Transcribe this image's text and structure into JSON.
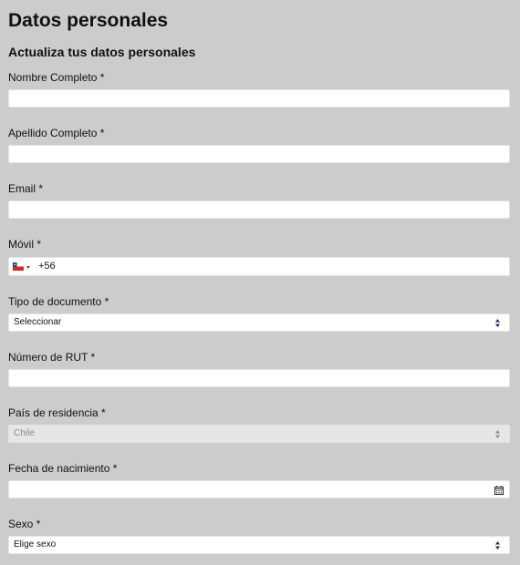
{
  "page": {
    "title": "Datos personales",
    "subtitle": "Actualiza tus datos personales"
  },
  "fields": {
    "nombre": {
      "label": "Nombre Completo *",
      "value": ""
    },
    "apellido": {
      "label": "Apellido Completo *",
      "value": ""
    },
    "email": {
      "label": "Email *",
      "value": ""
    },
    "movil": {
      "label": "Móvil *",
      "prefix": "+56",
      "flag_icon": "chile-flag-icon"
    },
    "tipo_documento": {
      "label": "Tipo de documento *",
      "selected": "Seleccionar"
    },
    "rut": {
      "label": "Número de RUT *",
      "value": ""
    },
    "pais": {
      "label": "País de residencia *",
      "selected": "Chile",
      "disabled": true
    },
    "fecha": {
      "label": "Fecha de nacimiento *",
      "value": "",
      "icon": "calendar-icon"
    },
    "sexo": {
      "label": "Sexo *",
      "selected": "Elige sexo"
    }
  },
  "colors": {
    "background": "#cccccc",
    "field_background": "#ffffff",
    "disabled_field_background": "#e6e6e6",
    "select_arrow": "#1f2a6b"
  }
}
